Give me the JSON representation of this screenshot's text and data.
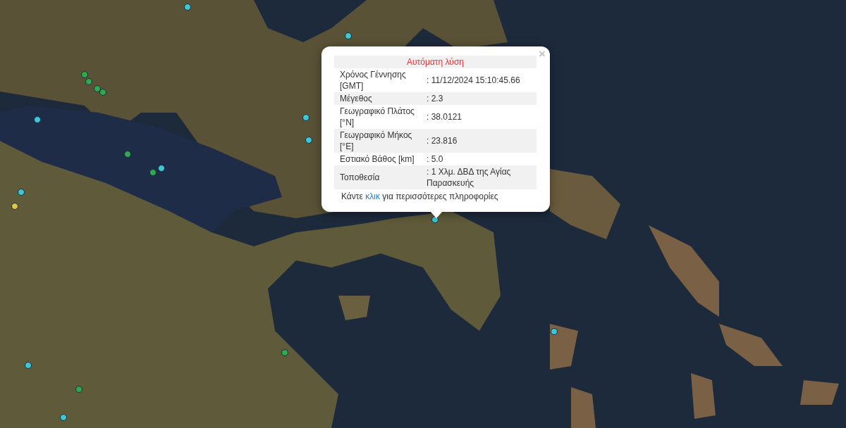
{
  "popup": {
    "close": "×",
    "title": "Αυτόματη λύση",
    "rows": [
      {
        "label": "Χρόνος Γέννησης [GMT]",
        "value": ": 11/12/2024 15:10:45.66"
      },
      {
        "label": "Μέγεθος",
        "value": ": 2.3"
      },
      {
        "label": "Γεωγραφικό Πλάτος [°N]",
        "value": ": 38.0121"
      },
      {
        "label": "Γεωγραφικό Μήκος [°E]",
        "value": ": 23.816"
      },
      {
        "label": "Εστιακό Βάθος [km]",
        "value": ": 5.0"
      },
      {
        "label": "Τοποθεσία",
        "value": ": 1 Χλμ. ΔΒΔ της Αγίας Παρασκευής"
      }
    ],
    "footer": {
      "before": "Κάντε",
      "link": "κλικ",
      "after": "για περισσότερες πληροφορίες"
    }
  },
  "markers": [
    {
      "color": "#3ec6d6"
    },
    {
      "color": "#3ec6d6"
    },
    {
      "color": "#3ec6d6"
    },
    {
      "color": "#3ec6d6"
    },
    {
      "color": "#3ec6d6"
    },
    {
      "color": "#3ec6d6"
    },
    {
      "color": "#3ec6d6"
    },
    {
      "color": "#3ec6d6"
    },
    {
      "color": "#3ec6d6"
    },
    {
      "color": "#3ec6d6"
    },
    {
      "color": "#3ec6d6"
    },
    {
      "color": "#2fa84f"
    },
    {
      "color": "#2fa84f"
    },
    {
      "color": "#2fa84f"
    },
    {
      "color": "#2fa84f"
    },
    {
      "color": "#2fa84f"
    },
    {
      "color": "#2fa84f"
    },
    {
      "color": "#2fa84f"
    },
    {
      "color": "#2fa84f"
    },
    {
      "color": "#e2c443"
    }
  ]
}
